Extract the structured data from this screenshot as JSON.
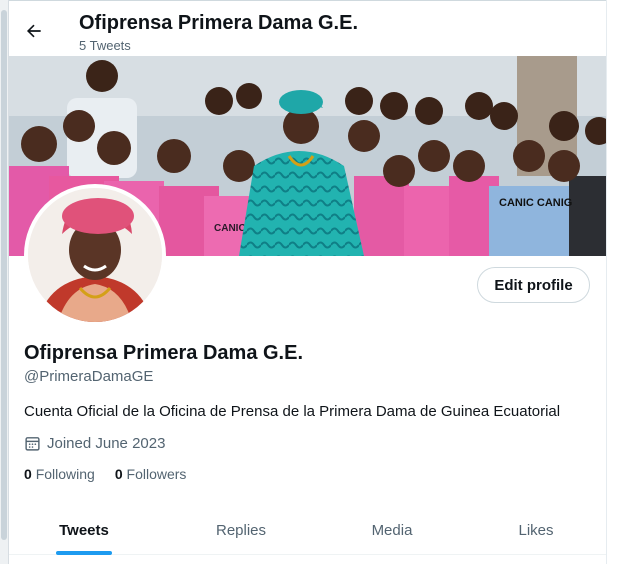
{
  "header": {
    "title": "Ofiprensa Primera Dama G.E.",
    "subtitle": "5 Tweets",
    "back_icon": "arrow-left-icon"
  },
  "profile": {
    "display_name": "Ofiprensa Primera Dama G.E.",
    "handle": "@PrimeraDamaGE",
    "bio": "Cuenta Oficial de la Oficina de Prensa de la Primera Dama de Guinea Ecuatorial",
    "joined": "Joined June 2023",
    "joined_icon": "calendar-icon",
    "following_count": "0",
    "following_label": "Following",
    "followers_count": "0",
    "followers_label": "Followers",
    "edit_label": "Edit profile"
  },
  "tabs": [
    {
      "label": "Tweets",
      "active": true
    },
    {
      "label": "Replies",
      "active": false
    },
    {
      "label": "Media",
      "active": false
    },
    {
      "label": "Likes",
      "active": false
    }
  ],
  "banner": {
    "shirt_text_1": "CANIC CANIG",
    "shirt_text_2": "CANIC"
  },
  "colors": {
    "accent": "#1d9bf0",
    "text_primary": "#0f1419",
    "text_secondary": "#536471",
    "border": "#cfd9de"
  }
}
